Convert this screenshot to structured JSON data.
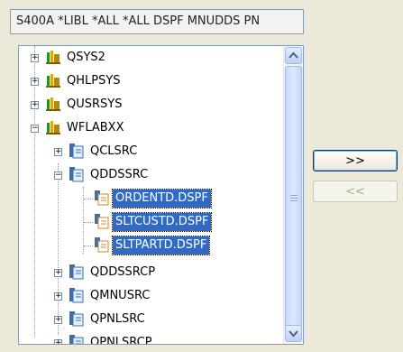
{
  "filter": {
    "text": "S400A *LIBL *ALL *ALL DSPF MNUDDS PN"
  },
  "tree": {
    "items": [
      {
        "label": "QSYS2",
        "kind": "library",
        "expanded": false,
        "selected": false
      },
      {
        "label": "QHLPSYS",
        "kind": "library",
        "expanded": false,
        "selected": false
      },
      {
        "label": "QUSRSYS",
        "kind": "library",
        "expanded": false,
        "selected": false
      },
      {
        "label": "WFLABXX",
        "kind": "library",
        "expanded": true,
        "selected": false
      },
      {
        "label": "QCLSRC",
        "kind": "source-file",
        "expanded": false,
        "selected": false
      },
      {
        "label": "QDDSSRC",
        "kind": "source-file",
        "expanded": true,
        "selected": false
      },
      {
        "label": "ORDENTD.DSPF",
        "kind": "member",
        "selected": true
      },
      {
        "label": "SLTCUSTD.DSPF",
        "kind": "member",
        "selected": true
      },
      {
        "label": "SLTPARTD.DSPF",
        "kind": "member",
        "selected": true
      },
      {
        "label": "QDDSSRCP",
        "kind": "source-file",
        "expanded": false,
        "selected": false
      },
      {
        "label": "QMNUSRC",
        "kind": "source-file",
        "expanded": false,
        "selected": false
      },
      {
        "label": "QPNLSRC",
        "kind": "source-file",
        "expanded": false,
        "selected": false
      },
      {
        "label": "QPNLSRCP",
        "kind": "source-file",
        "expanded": false,
        "selected": false
      }
    ]
  },
  "buttons": {
    "add_label": ">>",
    "remove_label": "<<"
  },
  "colors": {
    "selection": "#316ac5",
    "library_icon": "#d9a81e",
    "file_icon": "#3a6fb0"
  }
}
